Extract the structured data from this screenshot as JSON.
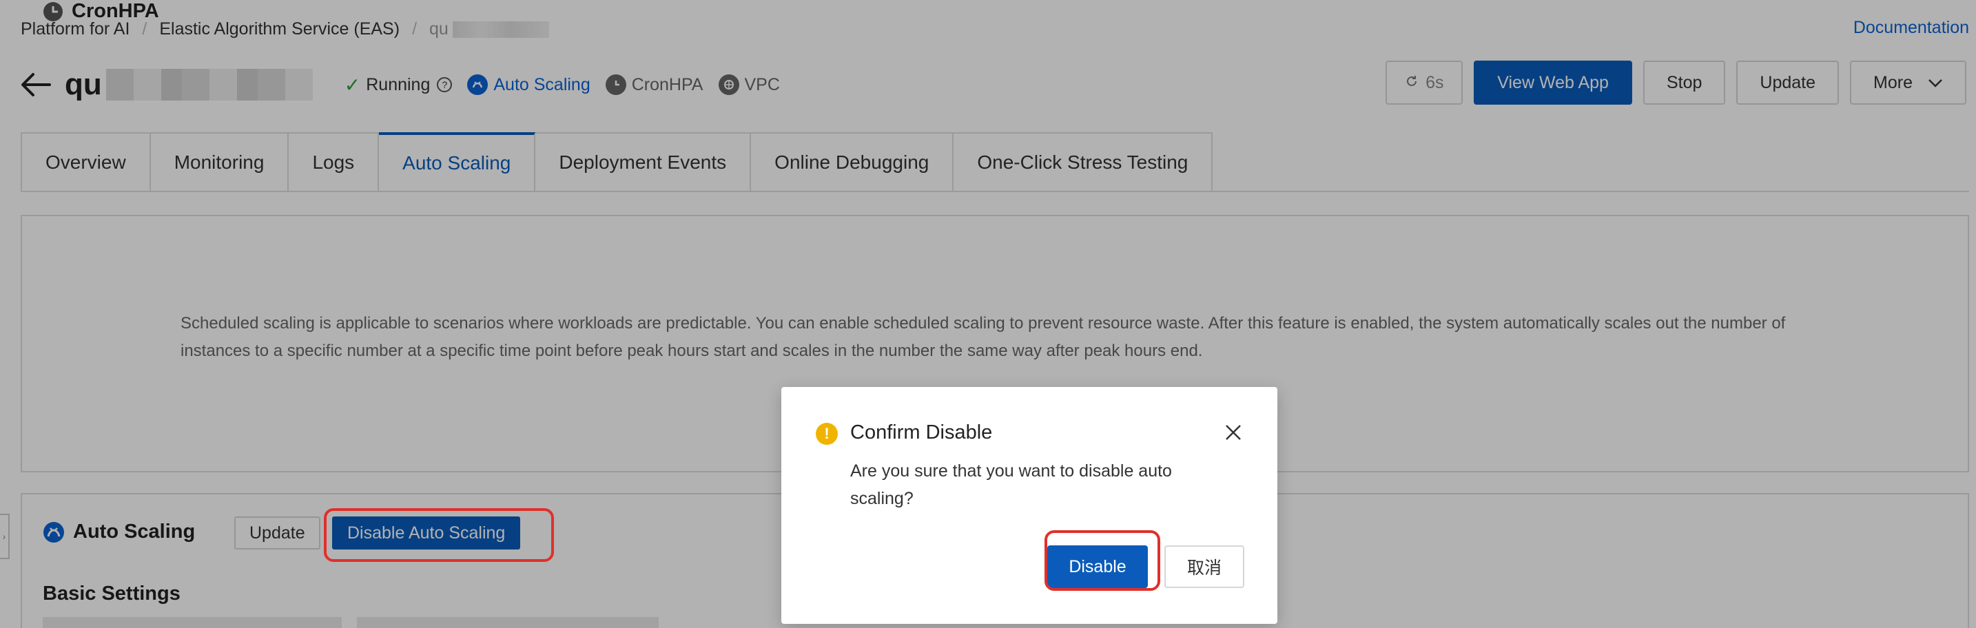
{
  "breadcrumb": {
    "items": [
      "Platform for AI",
      "Elastic Algorithm Service (EAS)",
      "qu"
    ],
    "documentation": "Documentation"
  },
  "header": {
    "service_name_prefix": "qu",
    "status": "Running",
    "tags": [
      "Auto Scaling",
      "CronHPA",
      "VPC"
    ],
    "refresh_label": "6s",
    "view_web_app": "View Web App",
    "stop": "Stop",
    "update": "Update",
    "more": "More"
  },
  "tabs": [
    {
      "label": "Overview"
    },
    {
      "label": "Monitoring"
    },
    {
      "label": "Logs"
    },
    {
      "label": "Auto Scaling",
      "active": true
    },
    {
      "label": "Deployment Events"
    },
    {
      "label": "Online Debugging"
    },
    {
      "label": "One-Click Stress Testing"
    }
  ],
  "cronhpa": {
    "title": "CronHPA",
    "description": "Scheduled scaling is applicable to scenarios where workloads are predictable. You can enable scheduled scaling to prevent resource waste. After this feature is enabled, the system automatically scales out the number of instances to a specific number at a specific time point before peak hours start and scales in the number the same way after peak hours end."
  },
  "auto_scaling": {
    "title": "Auto Scaling",
    "update": "Update",
    "disable": "Disable Auto Scaling",
    "basic_settings": "Basic Settings"
  },
  "modal": {
    "title": "Confirm Disable",
    "body": "Are you sure that you want to disable auto scaling?",
    "ok": "Disable",
    "cancel": "取消"
  },
  "colors": {
    "primary": "#0b5cba",
    "link": "#0b63d4",
    "highlight": "#e0302b",
    "warning": "#f0b400",
    "success": "#2a9d3a"
  }
}
